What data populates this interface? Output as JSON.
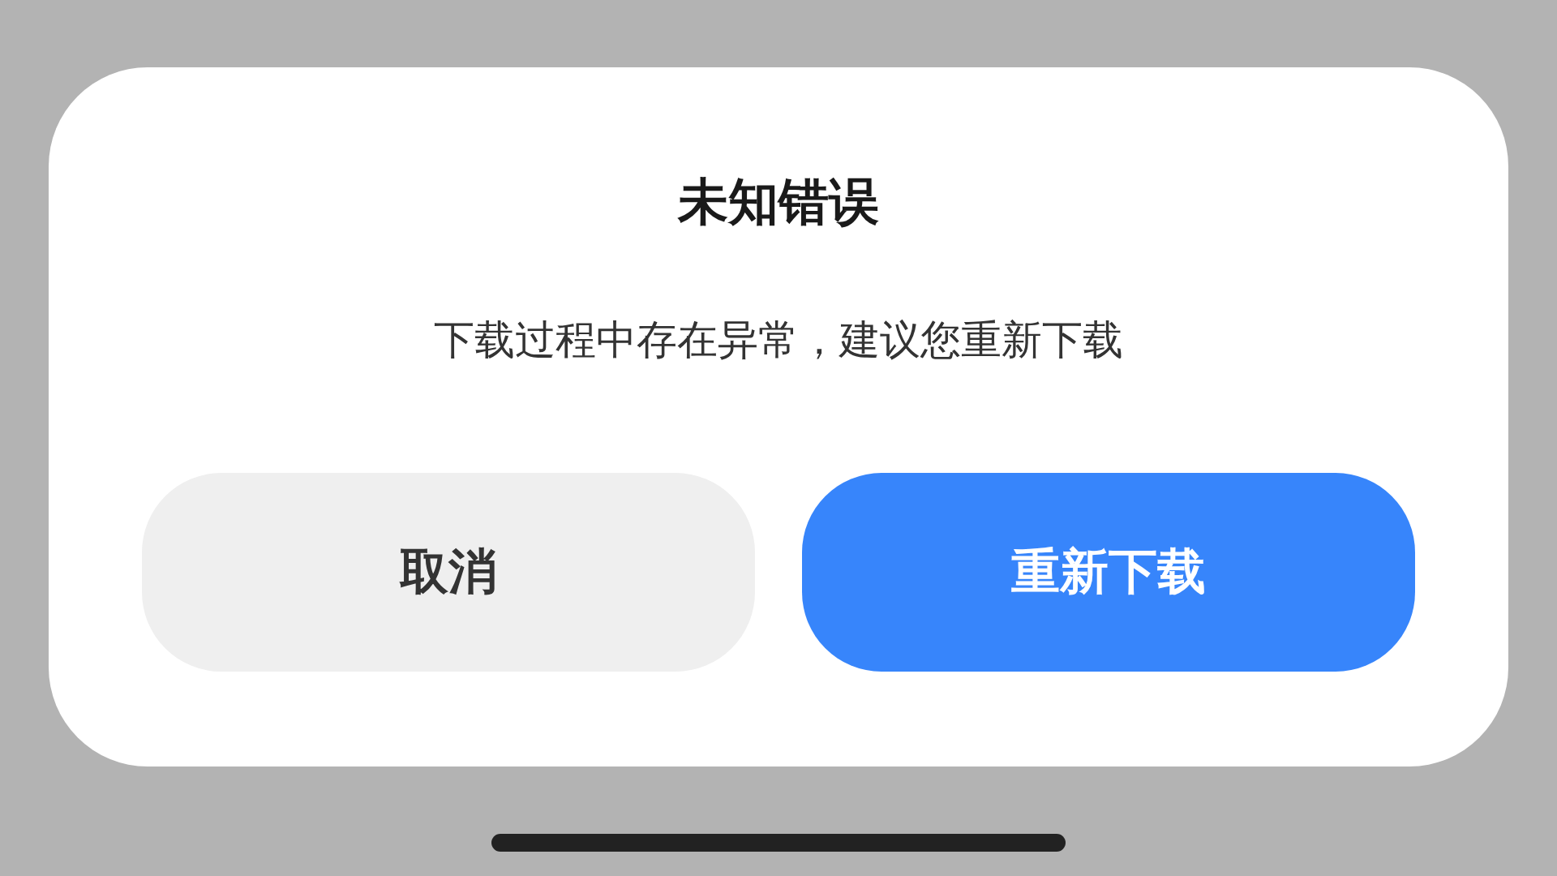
{
  "dialog": {
    "title": "未知错误",
    "message": "下载过程中存在异常，建议您重新下载",
    "buttons": [
      {
        "label": "取消",
        "kind": "secondary"
      },
      {
        "label": "重新下载",
        "kind": "primary"
      }
    ]
  }
}
